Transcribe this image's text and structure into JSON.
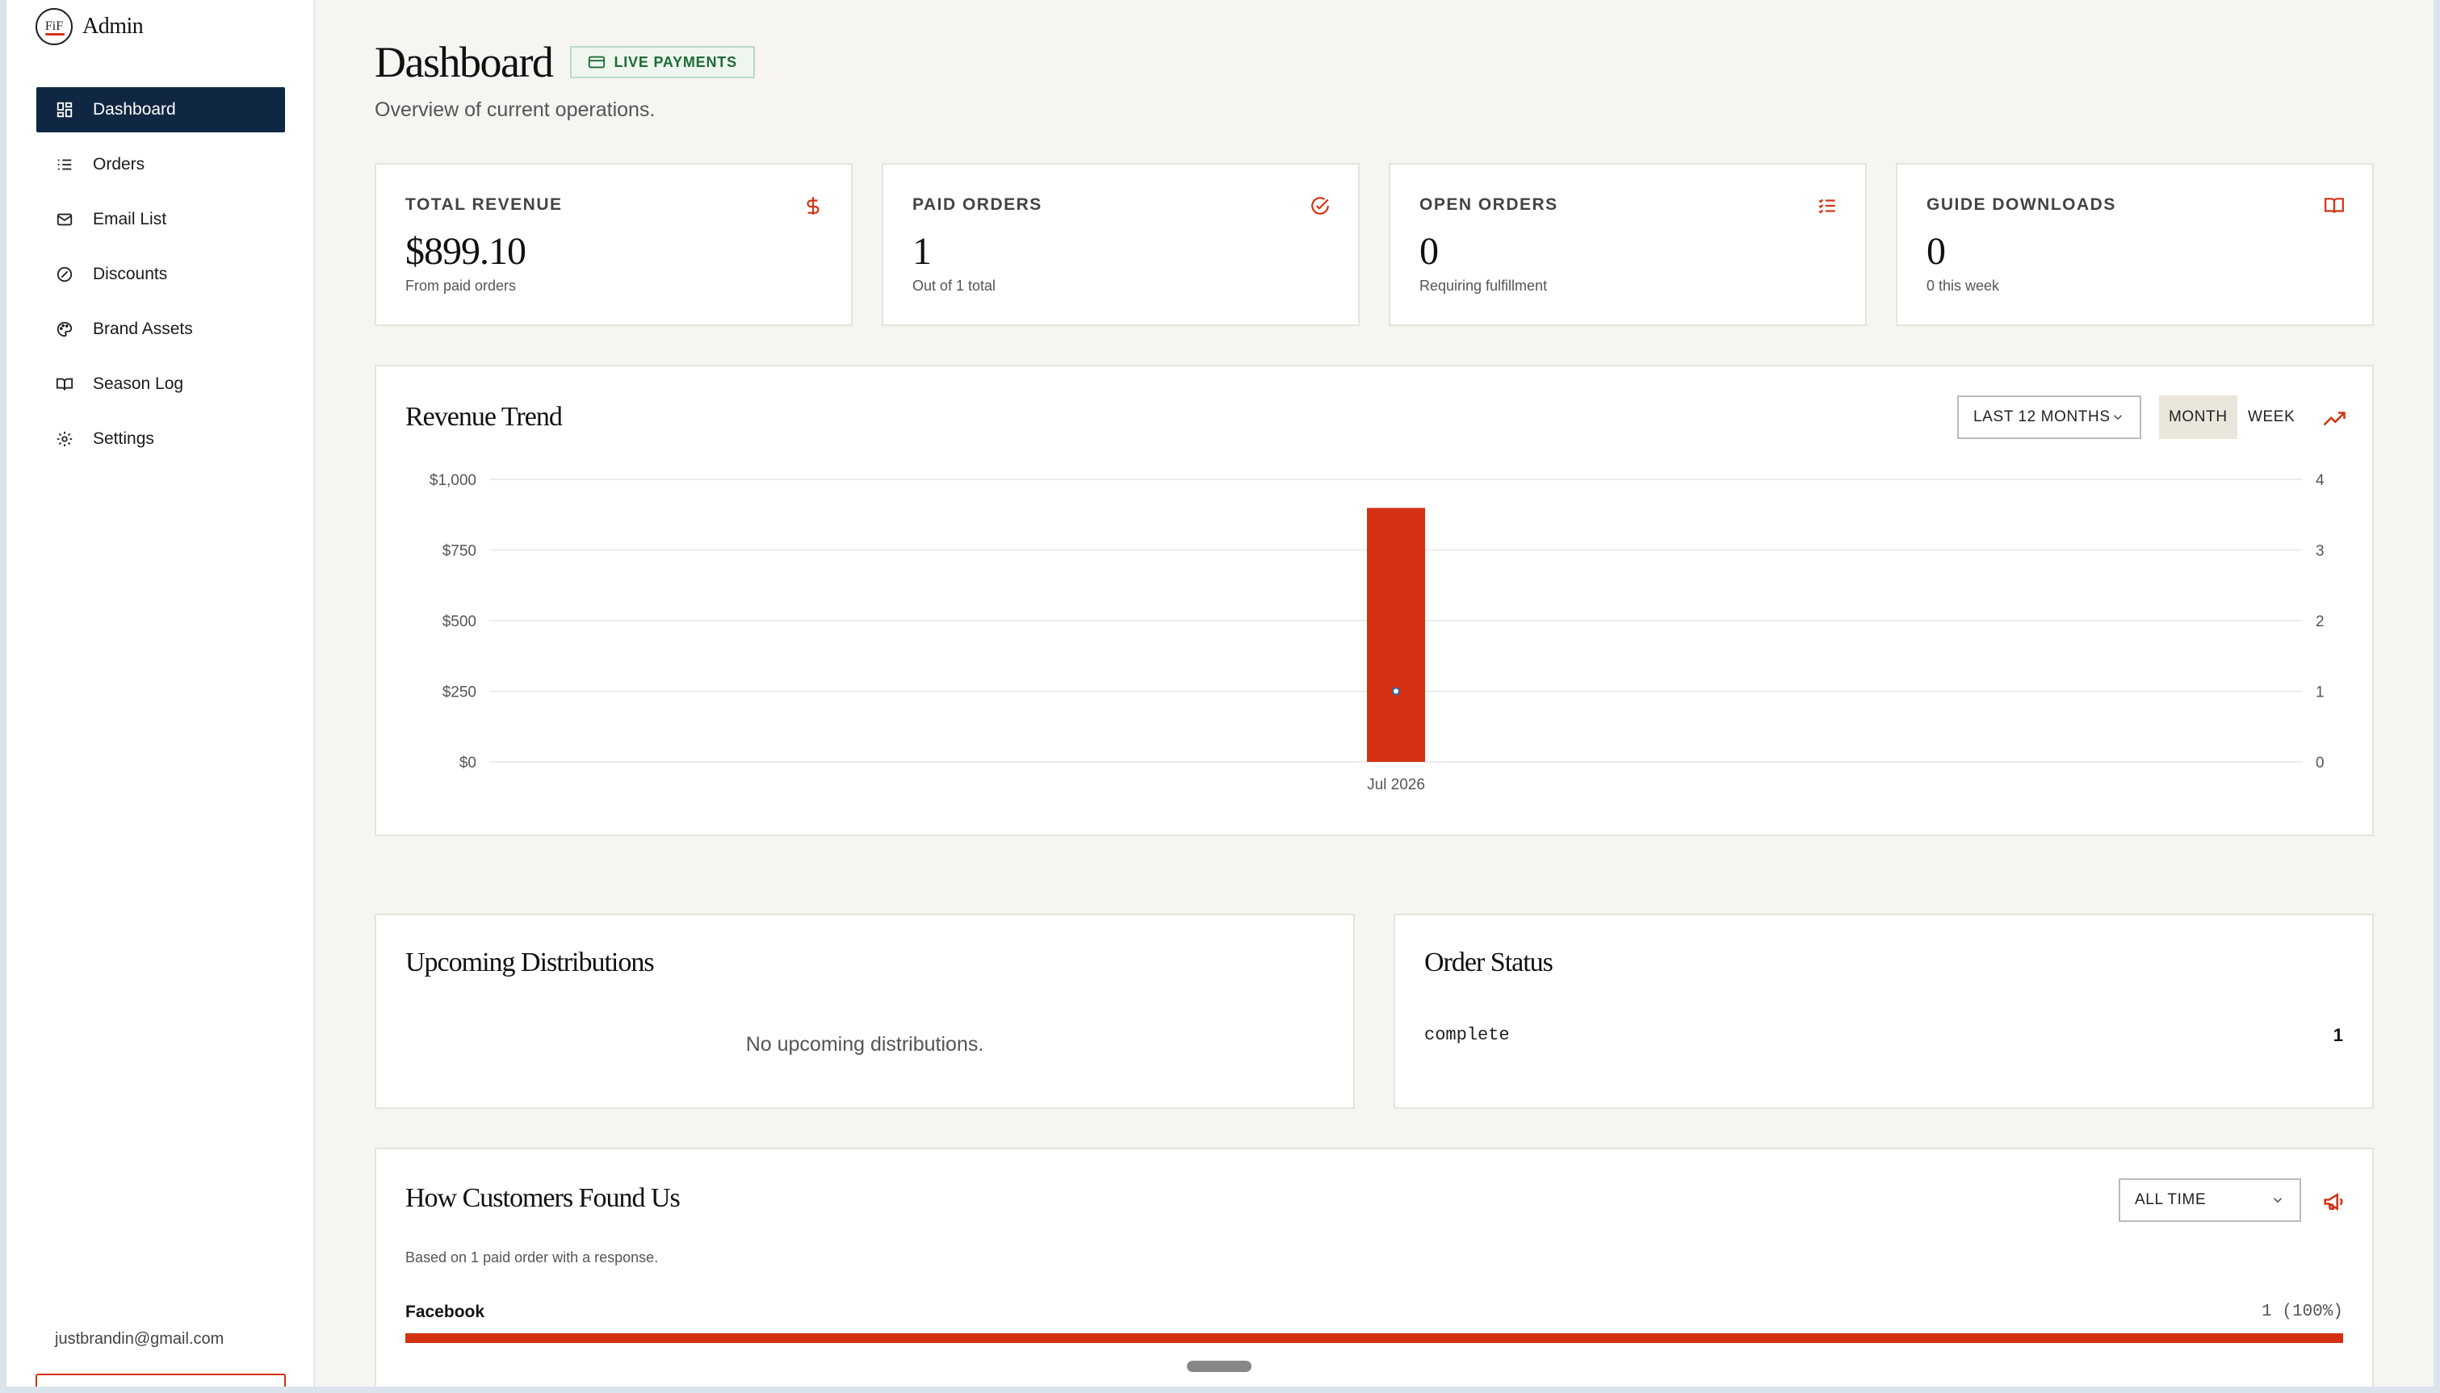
{
  "app": {
    "brand_title": "Admin",
    "logo_text": "FiF",
    "user_email": "justbrandin@gmail.com"
  },
  "sidebar": {
    "items": [
      {
        "label": "Dashboard",
        "icon": "dashboard-grid-icon",
        "active": true
      },
      {
        "label": "Orders",
        "icon": "list-icon",
        "active": false
      },
      {
        "label": "Email List",
        "icon": "mail-icon",
        "active": false
      },
      {
        "label": "Discounts",
        "icon": "discount-icon",
        "active": false
      },
      {
        "label": "Brand Assets",
        "icon": "palette-icon",
        "active": false
      },
      {
        "label": "Season Log",
        "icon": "book-icon",
        "active": false
      },
      {
        "label": "Settings",
        "icon": "gear-icon",
        "active": false
      }
    ]
  },
  "header": {
    "title": "Dashboard",
    "badge": "LIVE PAYMENTS",
    "subtitle": "Overview of current operations."
  },
  "stats": [
    {
      "label": "TOTAL REVENUE",
      "value": "$899.10",
      "note": "From paid orders",
      "icon": "dollar-icon"
    },
    {
      "label": "PAID ORDERS",
      "value": "1",
      "note": "Out of 1 total",
      "icon": "check-circle-icon"
    },
    {
      "label": "OPEN ORDERS",
      "value": "0",
      "note": "Requiring fulfillment",
      "icon": "list-check-icon"
    },
    {
      "label": "GUIDE DOWNLOADS",
      "value": "0",
      "note": "0 this week",
      "icon": "book-open-icon"
    }
  ],
  "revenue": {
    "title": "Revenue Trend",
    "range_select": "LAST 12 MONTHS",
    "toggle_month": "MONTH",
    "toggle_week": "WEEK",
    "accent": "#d33112"
  },
  "chart_data": {
    "type": "bar",
    "categories": [
      "Jul 2026"
    ],
    "series": [
      {
        "values": [
          899.1
        ],
        "axis": "left",
        "type": "bar"
      },
      {
        "values": [
          1
        ],
        "axis": "right",
        "type": "line"
      }
    ],
    "ylim": [
      0,
      1000
    ],
    "y_ticks": [
      "$0",
      "$250",
      "$500",
      "$750",
      "$1,000"
    ],
    "y2lim": [
      0,
      4
    ],
    "y2_ticks": [
      "0",
      "1",
      "2",
      "3",
      "4"
    ],
    "grid": true
  },
  "distributions": {
    "title": "Upcoming Distributions",
    "empty": "No upcoming distributions."
  },
  "order_status": {
    "title": "Order Status",
    "rows": [
      {
        "status": "complete",
        "count": "1"
      }
    ]
  },
  "found": {
    "title": "How Customers Found Us",
    "select": "ALL TIME",
    "note": "Based on 1 paid order with a response.",
    "sources": [
      {
        "name": "Facebook",
        "count": "1 (100%)",
        "share": 1.0
      }
    ]
  }
}
